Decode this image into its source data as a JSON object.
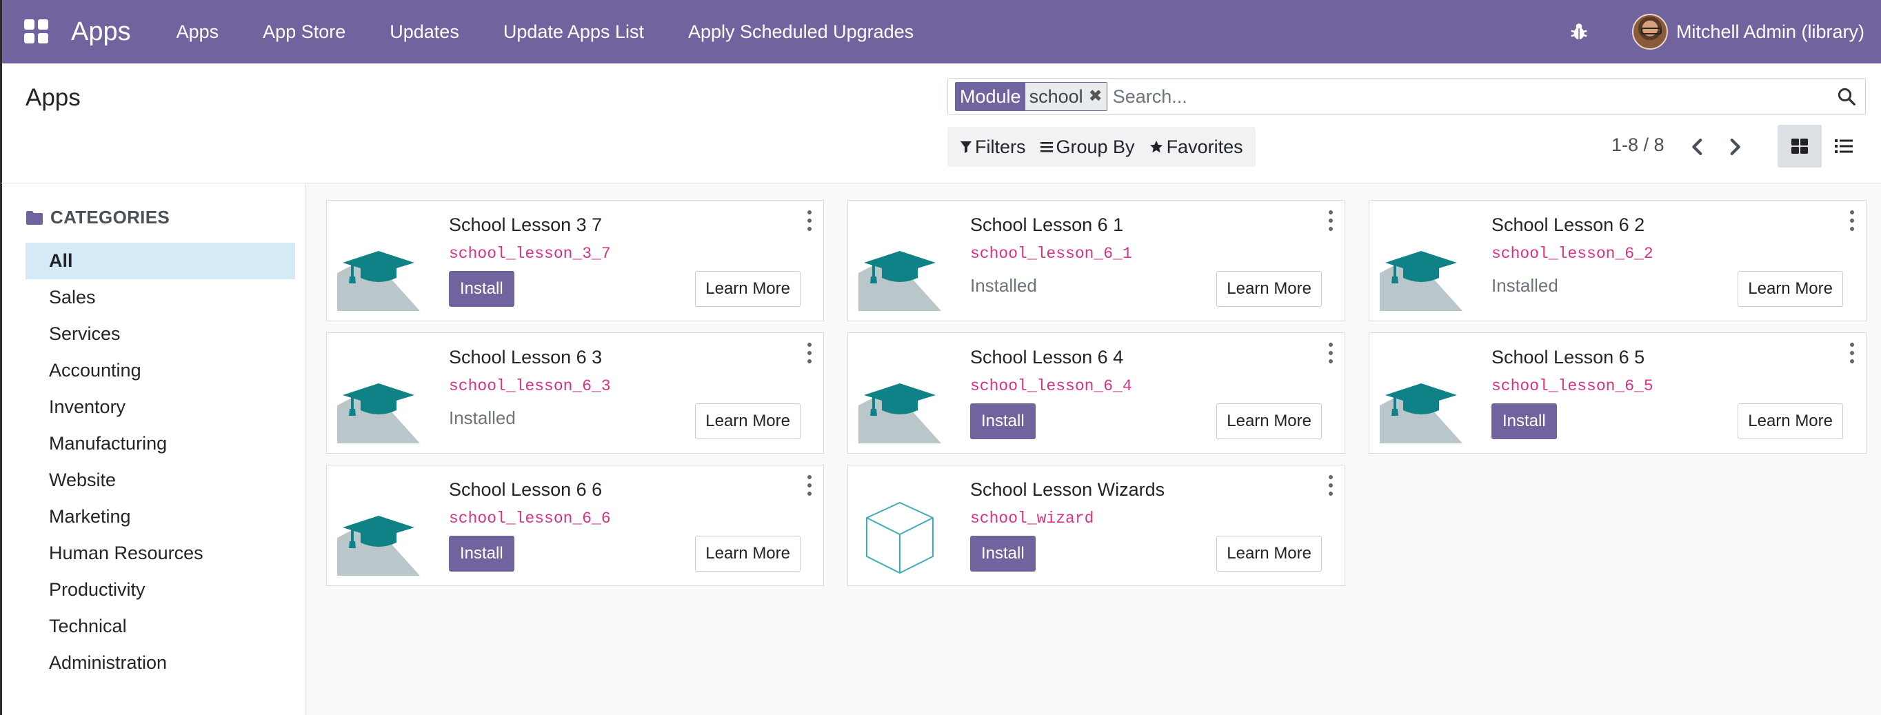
{
  "navbar": {
    "brand": "Apps",
    "menu": [
      "Apps",
      "App Store",
      "Updates",
      "Update Apps List",
      "Apply Scheduled Upgrades"
    ],
    "user_name": "Mitchell Admin (library)"
  },
  "control_panel": {
    "title": "Apps",
    "search": {
      "facet_label": "Module",
      "facet_value": "school",
      "placeholder": "Search..."
    },
    "filters": {
      "filters_label": "Filters",
      "group_by_label": "Group By",
      "favorites_label": "Favorites"
    },
    "pager": "1-8 / 8"
  },
  "sidebar": {
    "header": "CATEGORIES",
    "items": [
      "All",
      "Sales",
      "Services",
      "Accounting",
      "Inventory",
      "Manufacturing",
      "Website",
      "Marketing",
      "Human Resources",
      "Productivity",
      "Technical",
      "Administration"
    ],
    "active": "All"
  },
  "apps": [
    {
      "title": "School Lesson 3 7",
      "tech": "school_lesson_3_7",
      "state": "install",
      "icon": "graduation-cap-icon"
    },
    {
      "title": "School Lesson 6 1",
      "tech": "school_lesson_6_1",
      "state": "installed",
      "icon": "graduation-cap-icon"
    },
    {
      "title": "School Lesson 6 2",
      "tech": "school_lesson_6_2",
      "state": "installed",
      "icon": "graduation-cap-icon"
    },
    {
      "title": "School Lesson 6 3",
      "tech": "school_lesson_6_3",
      "state": "installed",
      "icon": "graduation-cap-icon"
    },
    {
      "title": "School Lesson 6 4",
      "tech": "school_lesson_6_4",
      "state": "install",
      "icon": "graduation-cap-icon"
    },
    {
      "title": "School Lesson 6 5",
      "tech": "school_lesson_6_5",
      "state": "install",
      "icon": "graduation-cap-icon"
    },
    {
      "title": "School Lesson 6 6",
      "tech": "school_lesson_6_6",
      "state": "install",
      "icon": "graduation-cap-icon"
    },
    {
      "title": "School Lesson Wizards",
      "tech": "school_wizard",
      "state": "install",
      "icon": "cube-icon"
    }
  ],
  "labels": {
    "install": "Install",
    "installed": "Installed",
    "learn_more": "Learn More"
  },
  "colors": {
    "brand": "#71639e",
    "tech_name": "#d63384",
    "active_category": "#d5e9f6",
    "icon_teal": "#0f8287"
  }
}
